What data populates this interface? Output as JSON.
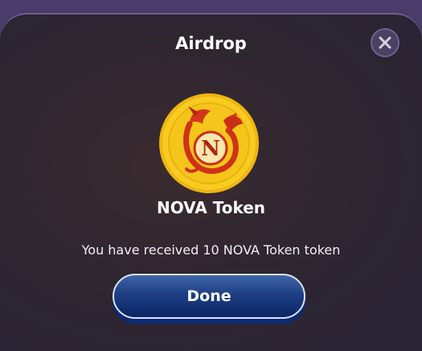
{
  "modal": {
    "title": "Airdrop",
    "token_name": "NOVA Token",
    "message": "You have received 10 NOVA Token token",
    "done_label": "Done",
    "close_icon": "close-icon",
    "coin_icon": "dragon-coin-icon",
    "coin_letter": "N"
  },
  "colors": {
    "coin_gold": "#f5c51b",
    "dragon_red": "#d2341c",
    "button_blue": "#1d3f82",
    "modal_border": "#6c5c92"
  }
}
